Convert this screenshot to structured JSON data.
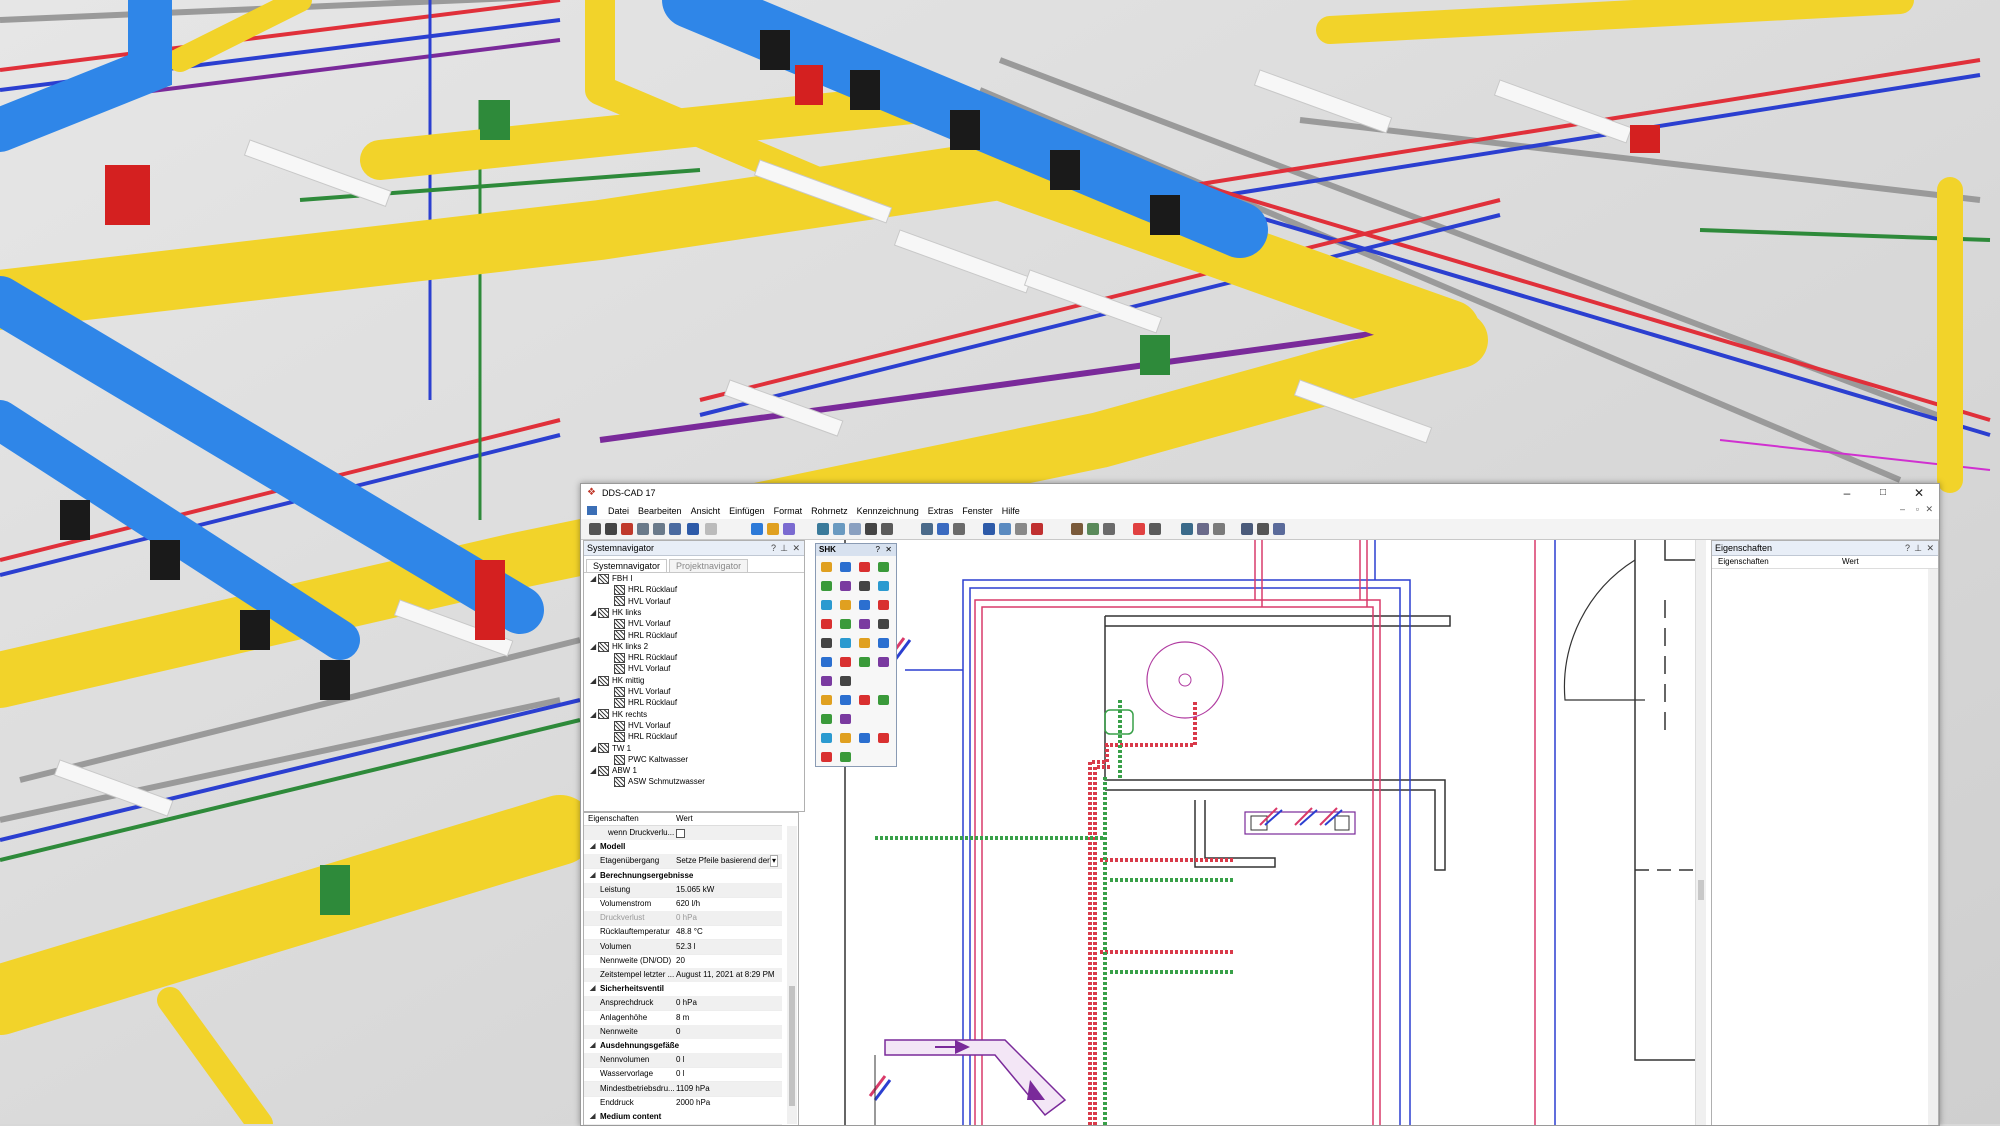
{
  "window": {
    "title": "DDS-CAD 17",
    "controls": {
      "minimize": "–",
      "maximize": "□",
      "close": "✕"
    },
    "mdi_controls": {
      "minimize": "–",
      "restore": "▫",
      "close": "✕"
    }
  },
  "menu": [
    "Datei",
    "Bearbeiten",
    "Ansicht",
    "Einfügen",
    "Format",
    "Rohrnetz",
    "Kennzeichnung",
    "Extras",
    "Fenster",
    "Hilfe"
  ],
  "left_panel": {
    "title": "Systemnavigator",
    "controls": {
      "help": "?",
      "pin": "⊥",
      "close": "✕"
    },
    "tabs": [
      "Systemnavigator",
      "Projektnavigator"
    ],
    "tree": [
      {
        "label": "FBH I",
        "level": 0,
        "toggle": "◢"
      },
      {
        "label": "HRL Rücklauf",
        "level": 1,
        "toggle": ""
      },
      {
        "label": "HVL Vorlauf",
        "level": 1,
        "toggle": ""
      },
      {
        "label": "HK links",
        "level": 0,
        "toggle": "◢"
      },
      {
        "label": "HVL Vorlauf",
        "level": 1,
        "toggle": ""
      },
      {
        "label": "HRL Rücklauf",
        "level": 1,
        "toggle": ""
      },
      {
        "label": "HK links 2",
        "level": 0,
        "toggle": "◢"
      },
      {
        "label": "HRL Rücklauf",
        "level": 1,
        "toggle": ""
      },
      {
        "label": "HVL Vorlauf",
        "level": 1,
        "toggle": ""
      },
      {
        "label": "HK mittig",
        "level": 0,
        "toggle": "◢"
      },
      {
        "label": "HVL Vorlauf",
        "level": 1,
        "toggle": ""
      },
      {
        "label": "HRL Rücklauf",
        "level": 1,
        "toggle": ""
      },
      {
        "label": "HK rechts",
        "level": 0,
        "toggle": "◢"
      },
      {
        "label": "HVL Vorlauf",
        "level": 1,
        "toggle": ""
      },
      {
        "label": "HRL Rücklauf",
        "level": 1,
        "toggle": ""
      },
      {
        "label": "TW 1",
        "level": 0,
        "toggle": "◢"
      },
      {
        "label": "PWC  Kaltwasser",
        "level": 1,
        "toggle": ""
      },
      {
        "label": "ABW 1",
        "level": 0,
        "toggle": "◢"
      },
      {
        "label": "ASW Schmutzwasser",
        "level": 1,
        "toggle": ""
      }
    ]
  },
  "properties_left": {
    "header_name": "Eigenschaften",
    "header_value": "Wert",
    "rows": [
      {
        "name": "wenn Druckverlu...",
        "value": "",
        "type": "checkbox"
      },
      {
        "name": "Modell",
        "value": "",
        "type": "section"
      },
      {
        "name": "Etagenübergang",
        "value": "Setze Pfeile basierend der F",
        "type": "dropdown"
      },
      {
        "name": "Berechnungsergebnisse",
        "value": "",
        "type": "section"
      },
      {
        "name": "Leistung",
        "value": "15.065 kW",
        "type": "value"
      },
      {
        "name": "Volumenstrom",
        "value": "620 l/h",
        "type": "value"
      },
      {
        "name": "Druckverlust",
        "value": "0 hPa",
        "type": "disabled"
      },
      {
        "name": "Rücklauftemperatur",
        "value": "48.8 °C",
        "type": "value"
      },
      {
        "name": "Volumen",
        "value": "52.3 l",
        "type": "value"
      },
      {
        "name": "Nennweite (DN/OD)",
        "value": "20",
        "type": "value"
      },
      {
        "name": "Zeitstempel letzter ...",
        "value": "August 11, 2021 at 8:29 PM",
        "type": "value"
      },
      {
        "name": "Sicherheitsventil",
        "value": "",
        "type": "section"
      },
      {
        "name": "Ansprechdruck",
        "value": "0 hPa",
        "type": "value"
      },
      {
        "name": "Anlagenhöhe",
        "value": "8 m",
        "type": "value"
      },
      {
        "name": "Nennweite",
        "value": "0",
        "type": "value"
      },
      {
        "name": "Ausdehnungsgefäße",
        "value": "",
        "type": "section"
      },
      {
        "name": "Nennvolumen",
        "value": "0 l",
        "type": "value"
      },
      {
        "name": "Wasservorlage",
        "value": "0 l",
        "type": "value"
      },
      {
        "name": "Mindestbetriebsdru...",
        "value": "1109 hPa",
        "type": "value"
      },
      {
        "name": "Enddruck",
        "value": "2000 hPa",
        "type": "value"
      },
      {
        "name": "Medium content",
        "value": "",
        "type": "section"
      }
    ]
  },
  "shk_palette": {
    "title": "SHK",
    "controls": {
      "help": "?",
      "close": "✕"
    }
  },
  "right_panel": {
    "title": "Eigenschaften",
    "controls": {
      "help": "?",
      "pin": "⊥",
      "close": "✕"
    },
    "col_name": "Eigenschaften",
    "col_value": "Wert"
  },
  "colors": {
    "supply_red": "#e0303a",
    "return_blue": "#2b3fd0",
    "drainage_purple": "#7a2a9a",
    "gas_yellow": "#f2d32a",
    "duct_blue": "#2f86e8",
    "cable_green": "#2e8a3a",
    "accent": "#3b6fb6"
  }
}
